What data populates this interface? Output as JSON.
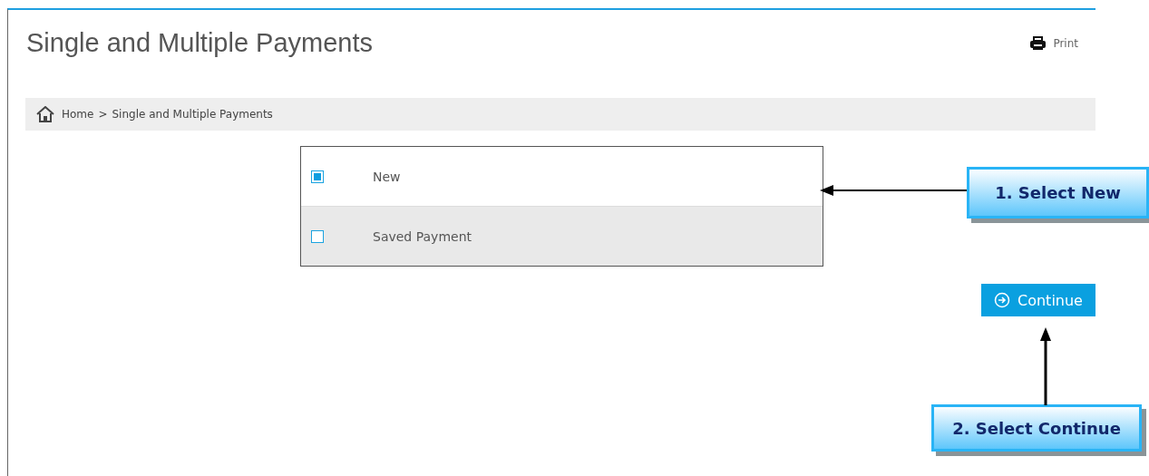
{
  "page": {
    "title": "Single and Multiple Payments",
    "print_label": "Print"
  },
  "breadcrumb": {
    "home": "Home",
    "separator": ">",
    "current": "Single and Multiple Payments"
  },
  "options": [
    {
      "label": "New",
      "selected": true
    },
    {
      "label": "Saved Payment",
      "selected": false
    }
  ],
  "continue_button": {
    "label": "Continue"
  },
  "callouts": [
    {
      "text": "1. Select New",
      "kind": "left"
    },
    {
      "text": "2. Select Continue",
      "kind": "up"
    }
  ]
}
